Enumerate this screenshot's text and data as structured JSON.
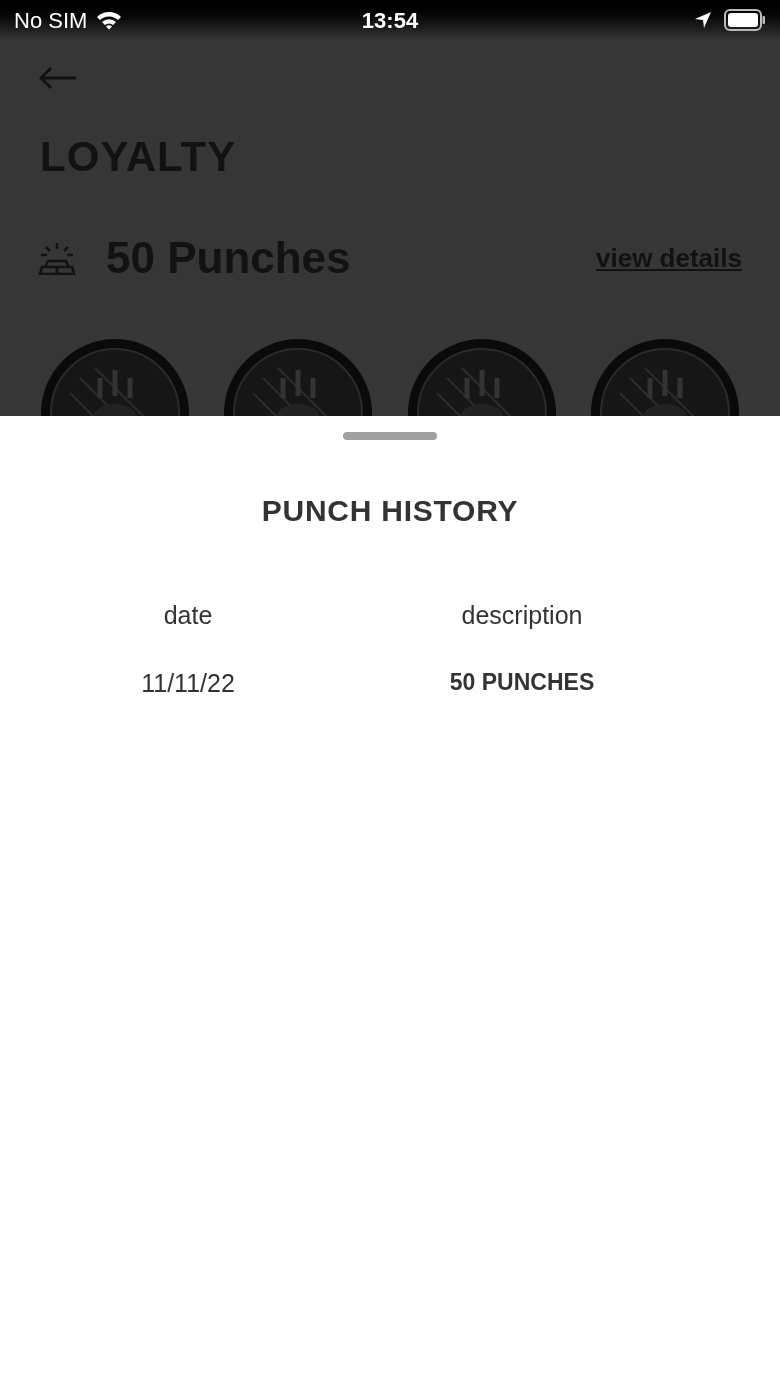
{
  "status_bar": {
    "carrier": "No SIM",
    "time": "13:54"
  },
  "page": {
    "title": "LOYALTY",
    "punches": "50 Punches",
    "link": "view details"
  },
  "sheet": {
    "title": "PUNCH HISTORY",
    "columns": [
      "date",
      "description"
    ],
    "rows": [
      {
        "date": "11/11/22",
        "description": "50 PUNCHES"
      }
    ]
  }
}
